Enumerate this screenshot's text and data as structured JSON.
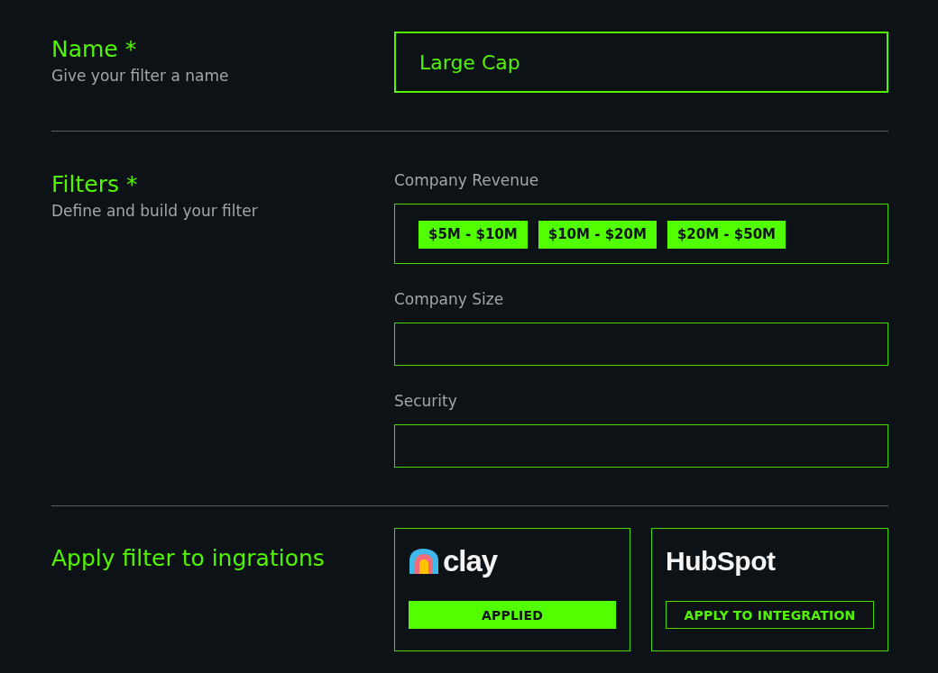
{
  "name_section": {
    "title": "Name *",
    "description": "Give your filter a name",
    "value": "Large Cap"
  },
  "filters_section": {
    "title": "Filters *",
    "description": "Define and build your filter",
    "fields": [
      {
        "label": "Company Revenue",
        "chips": [
          "$5M - $10M",
          "$10M - $20M",
          "$20M - $50M"
        ]
      },
      {
        "label": "Company Size"
      },
      {
        "label": "Security"
      }
    ]
  },
  "integrations_section": {
    "title": "Apply filter to ingrations",
    "integrations": [
      {
        "kind": "clay",
        "logo": "clay",
        "button": "APPLIED",
        "applied": true
      },
      {
        "kind": "hubspot",
        "logo": "HubSpot",
        "button": "APPLY TO INTEGRATION",
        "applied": false
      }
    ]
  }
}
